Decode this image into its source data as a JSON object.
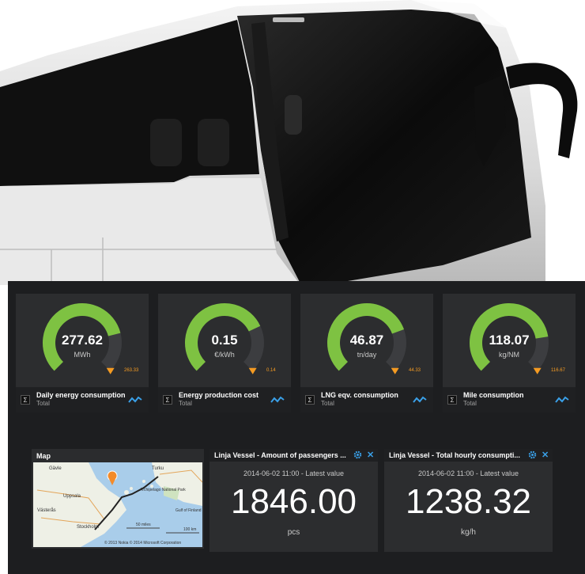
{
  "gauges": [
    {
      "value": "277.62",
      "unit": "MWh",
      "target": "263.33",
      "title": "Daily energy consumption",
      "subtitle": "Total",
      "fill": 0.78,
      "color": "#7ec242"
    },
    {
      "value": "0.15",
      "unit": "€/kWh",
      "target": "0.14",
      "title": "Energy production cost",
      "subtitle": "Total",
      "fill": 0.74,
      "color": "#7ec242"
    },
    {
      "value": "46.87",
      "unit": "tn/day",
      "target": "44.33",
      "title": "LNG eqv. consumption",
      "subtitle": "Total",
      "fill": 0.76,
      "color": "#7ec242"
    },
    {
      "value": "118.07",
      "unit": "kg/NM",
      "target": "116.67",
      "title": "Mile consumption",
      "subtitle": "Total",
      "fill": 0.8,
      "color": "#7ec242"
    }
  ],
  "map": {
    "title": "Map",
    "places": [
      "Gävle",
      "Turku",
      "Uppsala",
      "Västerås",
      "Stockholm",
      "Archipelago National Park",
      "Gulf of Finland"
    ],
    "scale": [
      "50 miles",
      "100 km"
    ],
    "copyright": "© 2013 Nokia   © 2014 Microsoft Corporation"
  },
  "panels": [
    {
      "title": "Linja Vessel - Amount of passengers ...",
      "time": "2014-06-02 11:00 - Latest value",
      "value": "1846.00",
      "unit": "pcs"
    },
    {
      "title": "Linja Vessel - Total hourly consumpti...",
      "time": "2014-06-02 11:00 - Latest value",
      "value": "1238.32",
      "unit": "kg/h"
    }
  ],
  "icons": {
    "sigma": "Σ",
    "close": "✕"
  },
  "colors": {
    "accent": "#3aa0e8",
    "gauge_green": "#7ec242",
    "target_orange": "#f59b22",
    "background": "#1d1e20",
    "card": "#2c2d2f"
  }
}
